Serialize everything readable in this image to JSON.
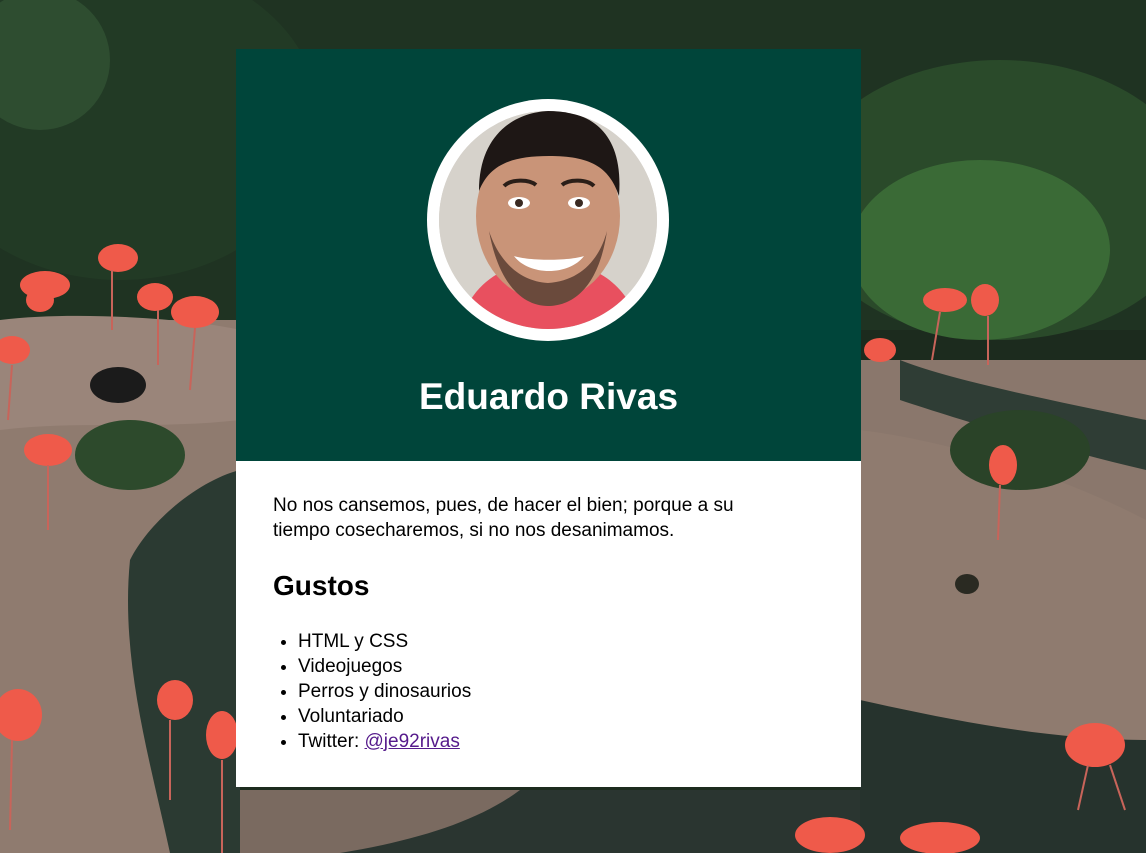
{
  "profile": {
    "name": "Eduardo Rivas",
    "quote": "No nos cansemos, pues, de hacer el bien; porque a su tiempo cosecharemos, si no nos desanimamos."
  },
  "likes": {
    "title": "Gustos",
    "items": [
      {
        "text": "HTML y CSS"
      },
      {
        "text": "Videojuegos"
      },
      {
        "text": "Perros y dinosaurios"
      },
      {
        "text": "Voluntariado"
      },
      {
        "text": "Twitter: ",
        "link": "@je92rivas"
      }
    ]
  },
  "background": {
    "icon": "flamingo-park-image",
    "colors": {
      "foliage": "#1f3322",
      "ground": "#8f7b6f",
      "water": "#2b3a32",
      "flamingo": "#ef5a4a"
    }
  },
  "colors": {
    "header": "#00453a",
    "card": "#ffffff",
    "link": "#551a8b"
  }
}
